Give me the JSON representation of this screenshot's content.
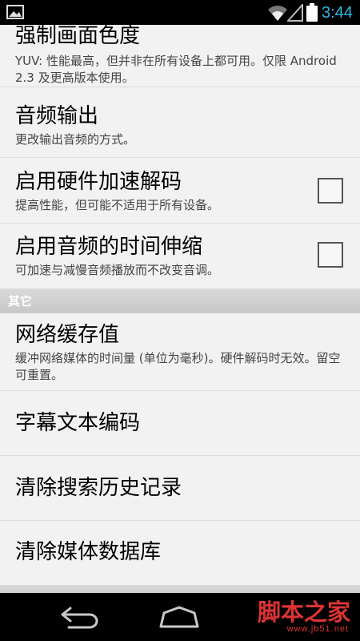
{
  "status_bar": {
    "time": "3:44",
    "icons": [
      "gallery-icon",
      "wifi-icon",
      "signal-icon",
      "battery-icon"
    ]
  },
  "preferences": {
    "force_chroma": {
      "title": "强制画面色度",
      "summary": "YUV: 性能最高，但并非在所有设备上都可用。仅限 Android 2.3 及更高版本使用。"
    },
    "audio_output": {
      "title": "音频输出",
      "summary": "更改输出音频的方式。"
    },
    "hardware_decoding": {
      "title": "启用硬件加速解码",
      "summary": "提高性能，但可能不适用于所有设备。",
      "checked": false
    },
    "time_stretch": {
      "title": "启用音频的时间伸缩",
      "summary": "可加速与减慢音频播放而不改变音调。",
      "checked": false
    }
  },
  "section_other": {
    "title": "其它",
    "network_cache": {
      "title": "网络缓存值",
      "summary": "缓冲网络媒体的时间量 (单位为毫秒)。硬件解码时无效。留空可重置。"
    },
    "subtitle_encoding": {
      "title": "字幕文本编码"
    },
    "clear_search": {
      "title": "清除搜索历史记录"
    },
    "clear_media_db": {
      "title": "清除媒体数据库"
    }
  },
  "nav_bar": {
    "icons": [
      "back-icon",
      "home-icon"
    ]
  },
  "watermark": {
    "main": "脚本之家",
    "url": "www.jb51.net"
  },
  "colors": {
    "clock_blue": "#33b5e5",
    "background": "#f2f2f2",
    "section_gray": "#cccccc",
    "watermark_red": "#dd3333"
  }
}
